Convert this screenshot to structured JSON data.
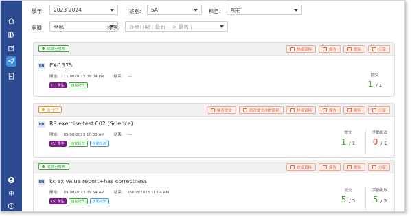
{
  "sidebar": {
    "lang_text": "中"
  },
  "filters": {
    "year_label": "學年:",
    "year_value": "2023-2024",
    "class_label": "班別:",
    "class_value": "5A",
    "subject_label": "科目:",
    "subject_value": "所有",
    "status_label": "狀態:",
    "status_value": "全部",
    "sort_label": "排序:",
    "sort_placeholder": "派發日期 ( 最新 ---> 最舊 )"
  },
  "actions": {
    "submit_label": "抽查提交",
    "deadline_label": "修改提交次數限期",
    "details_label": "詳細資料",
    "report_label": "報告",
    "delete_label": "刪除",
    "share_label": "分享"
  },
  "labels": {
    "open_prefix": "開始:",
    "end_prefix": "結束:",
    "submitted": "提交",
    "manual_grading": "手動批改"
  },
  "assignments": [
    {
      "status": "成績已發布",
      "lang": "EN",
      "title": "EX-1375",
      "open": "11/08/2023 09:04 PM",
      "end": "---",
      "students": "(1) 學生",
      "auto": "自動批改",
      "submitted": "1",
      "submitted_total": "/ 1"
    },
    {
      "status": "進行中",
      "lang": "EN",
      "title": "RS exercise test 002 (Science)",
      "open": "09/08/2023 10:03 AM",
      "end": "---",
      "students": "(1) 學生",
      "auto": "自動批改",
      "manual": "手動批改",
      "submitted": "1",
      "submitted_total": "/ 1",
      "graded": "0",
      "graded_total": "/ 1"
    },
    {
      "status": "成績已發布",
      "lang": "EN",
      "title": "kc ex value report+has correctness",
      "open": "09/08/2023 09:54 AM",
      "end": "09/08/2023 11:04 AM",
      "students": "(5) 學生",
      "auto": "自動批改",
      "manual": "手動批改",
      "submitted": "5",
      "submitted_total": "/ 5",
      "graded": "5",
      "graded_total": "/ 5"
    }
  ],
  "colors": {
    "sidebar": "#2c4a8f",
    "active": "#3d8fe0",
    "green": "#3aaa35",
    "orange": "#f0961c",
    "red": "#e24b3b",
    "purple": "#7d1a8a",
    "action": "#e06a4c"
  },
  "icons": [
    "home-icon",
    "library-icon",
    "edit-icon",
    "send-icon",
    "clipboard-icon",
    "user-icon",
    "help-icon"
  ]
}
